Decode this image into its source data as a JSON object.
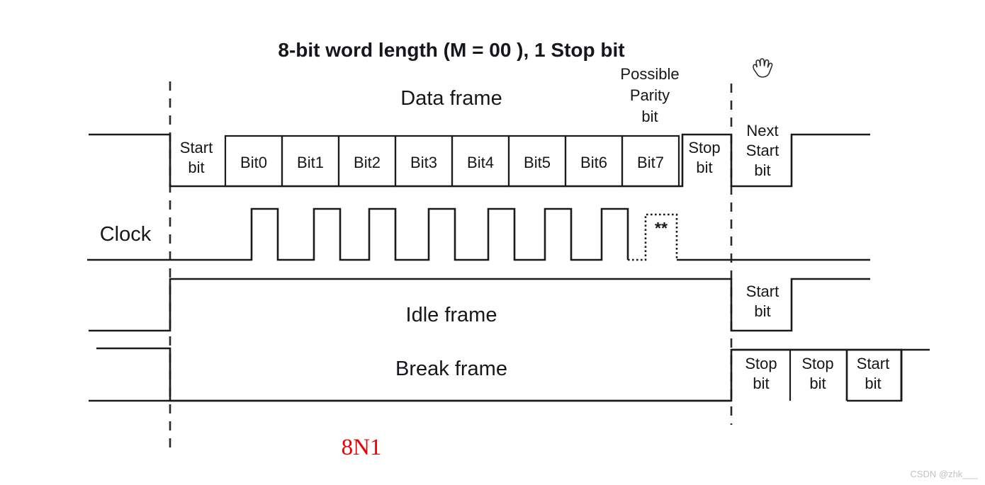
{
  "title": "8-bit word length (M = 00 ), 1 Stop bit",
  "labels": {
    "data_frame": "Data frame",
    "idle_frame": "Idle frame",
    "break_frame": "Break frame",
    "clock": "Clock",
    "parity_note_line1": "Possible",
    "parity_note_line2": "Parity",
    "parity_note_line3": "bit",
    "clock_marker": "**"
  },
  "data_frame_row": {
    "start_bit": {
      "line1": "Start",
      "line2": "bit"
    },
    "bits": [
      "Bit0",
      "Bit1",
      "Bit2",
      "Bit3",
      "Bit4",
      "Bit5",
      "Bit6",
      "Bit7"
    ],
    "stop_bit": {
      "line1": "Stop",
      "line2": "bit"
    },
    "next_start_bit": {
      "line1": "Next",
      "line2": "Start",
      "line3": "bit"
    }
  },
  "idle_frame_row": {
    "start_bit": {
      "line1": "Start",
      "line2": "bit"
    }
  },
  "break_frame_row": {
    "cells": [
      {
        "line1": "Stop",
        "line2": "bit"
      },
      {
        "line1": "Stop",
        "line2": "bit"
      },
      {
        "line1": "Start",
        "line2": "bit"
      }
    ]
  },
  "annotation": "8N1",
  "watermark": "CSDN @zhk___",
  "cursor": "grab-hand-cursor",
  "colors": {
    "ink": "#1b1b1b",
    "annotation": "#ee0000",
    "watermark": "#c2c2c2",
    "background": "#ffffff"
  },
  "chart_data": {
    "type": "line",
    "title": "8-bit word length (M = 00 ), 1 Stop bit",
    "xlabel": "",
    "ylabel": "",
    "grid": false,
    "legend": "none",
    "series": [
      {
        "name": "Data frame",
        "description": "Idle high, start bit low, 8 data bit cells, stop bit high, next start bit low, then high",
        "levels": [
          "high",
          "low",
          "data",
          "data",
          "data",
          "data",
          "data",
          "data",
          "data",
          "data",
          "high",
          "low",
          "high"
        ],
        "segment_labels": [
          "",
          "Start bit",
          "Bit0",
          "Bit1",
          "Bit2",
          "Bit3",
          "Bit4",
          "Bit5",
          "Bit6",
          "Bit7",
          "Stop bit",
          "Next Start bit",
          ""
        ]
      },
      {
        "name": "Clock",
        "description": "Square wave of 7 solid pulses beginning after start bit, plus one dotted optional pulse marked **",
        "pulse_count_solid": 7,
        "pulse_count_dotted": 1
      },
      {
        "name": "Idle frame",
        "description": "Low before marker, high through whole idle frame, low for start bit, then high",
        "levels": [
          "low",
          "high",
          "low",
          "high"
        ],
        "segment_labels": [
          "",
          "Idle frame",
          "Start bit",
          ""
        ]
      },
      {
        "name": "Break frame",
        "description": "High before marker, low through whole break frame, then stop bit, stop bit, start bit cells, then high",
        "levels": [
          "high",
          "low",
          "high",
          "high",
          "low",
          "high"
        ],
        "segment_labels": [
          "",
          "Break frame",
          "Stop bit",
          "Stop bit",
          "Start bit",
          ""
        ]
      }
    ],
    "annotations": [
      "Possible Parity bit",
      "**",
      "8N1"
    ]
  }
}
